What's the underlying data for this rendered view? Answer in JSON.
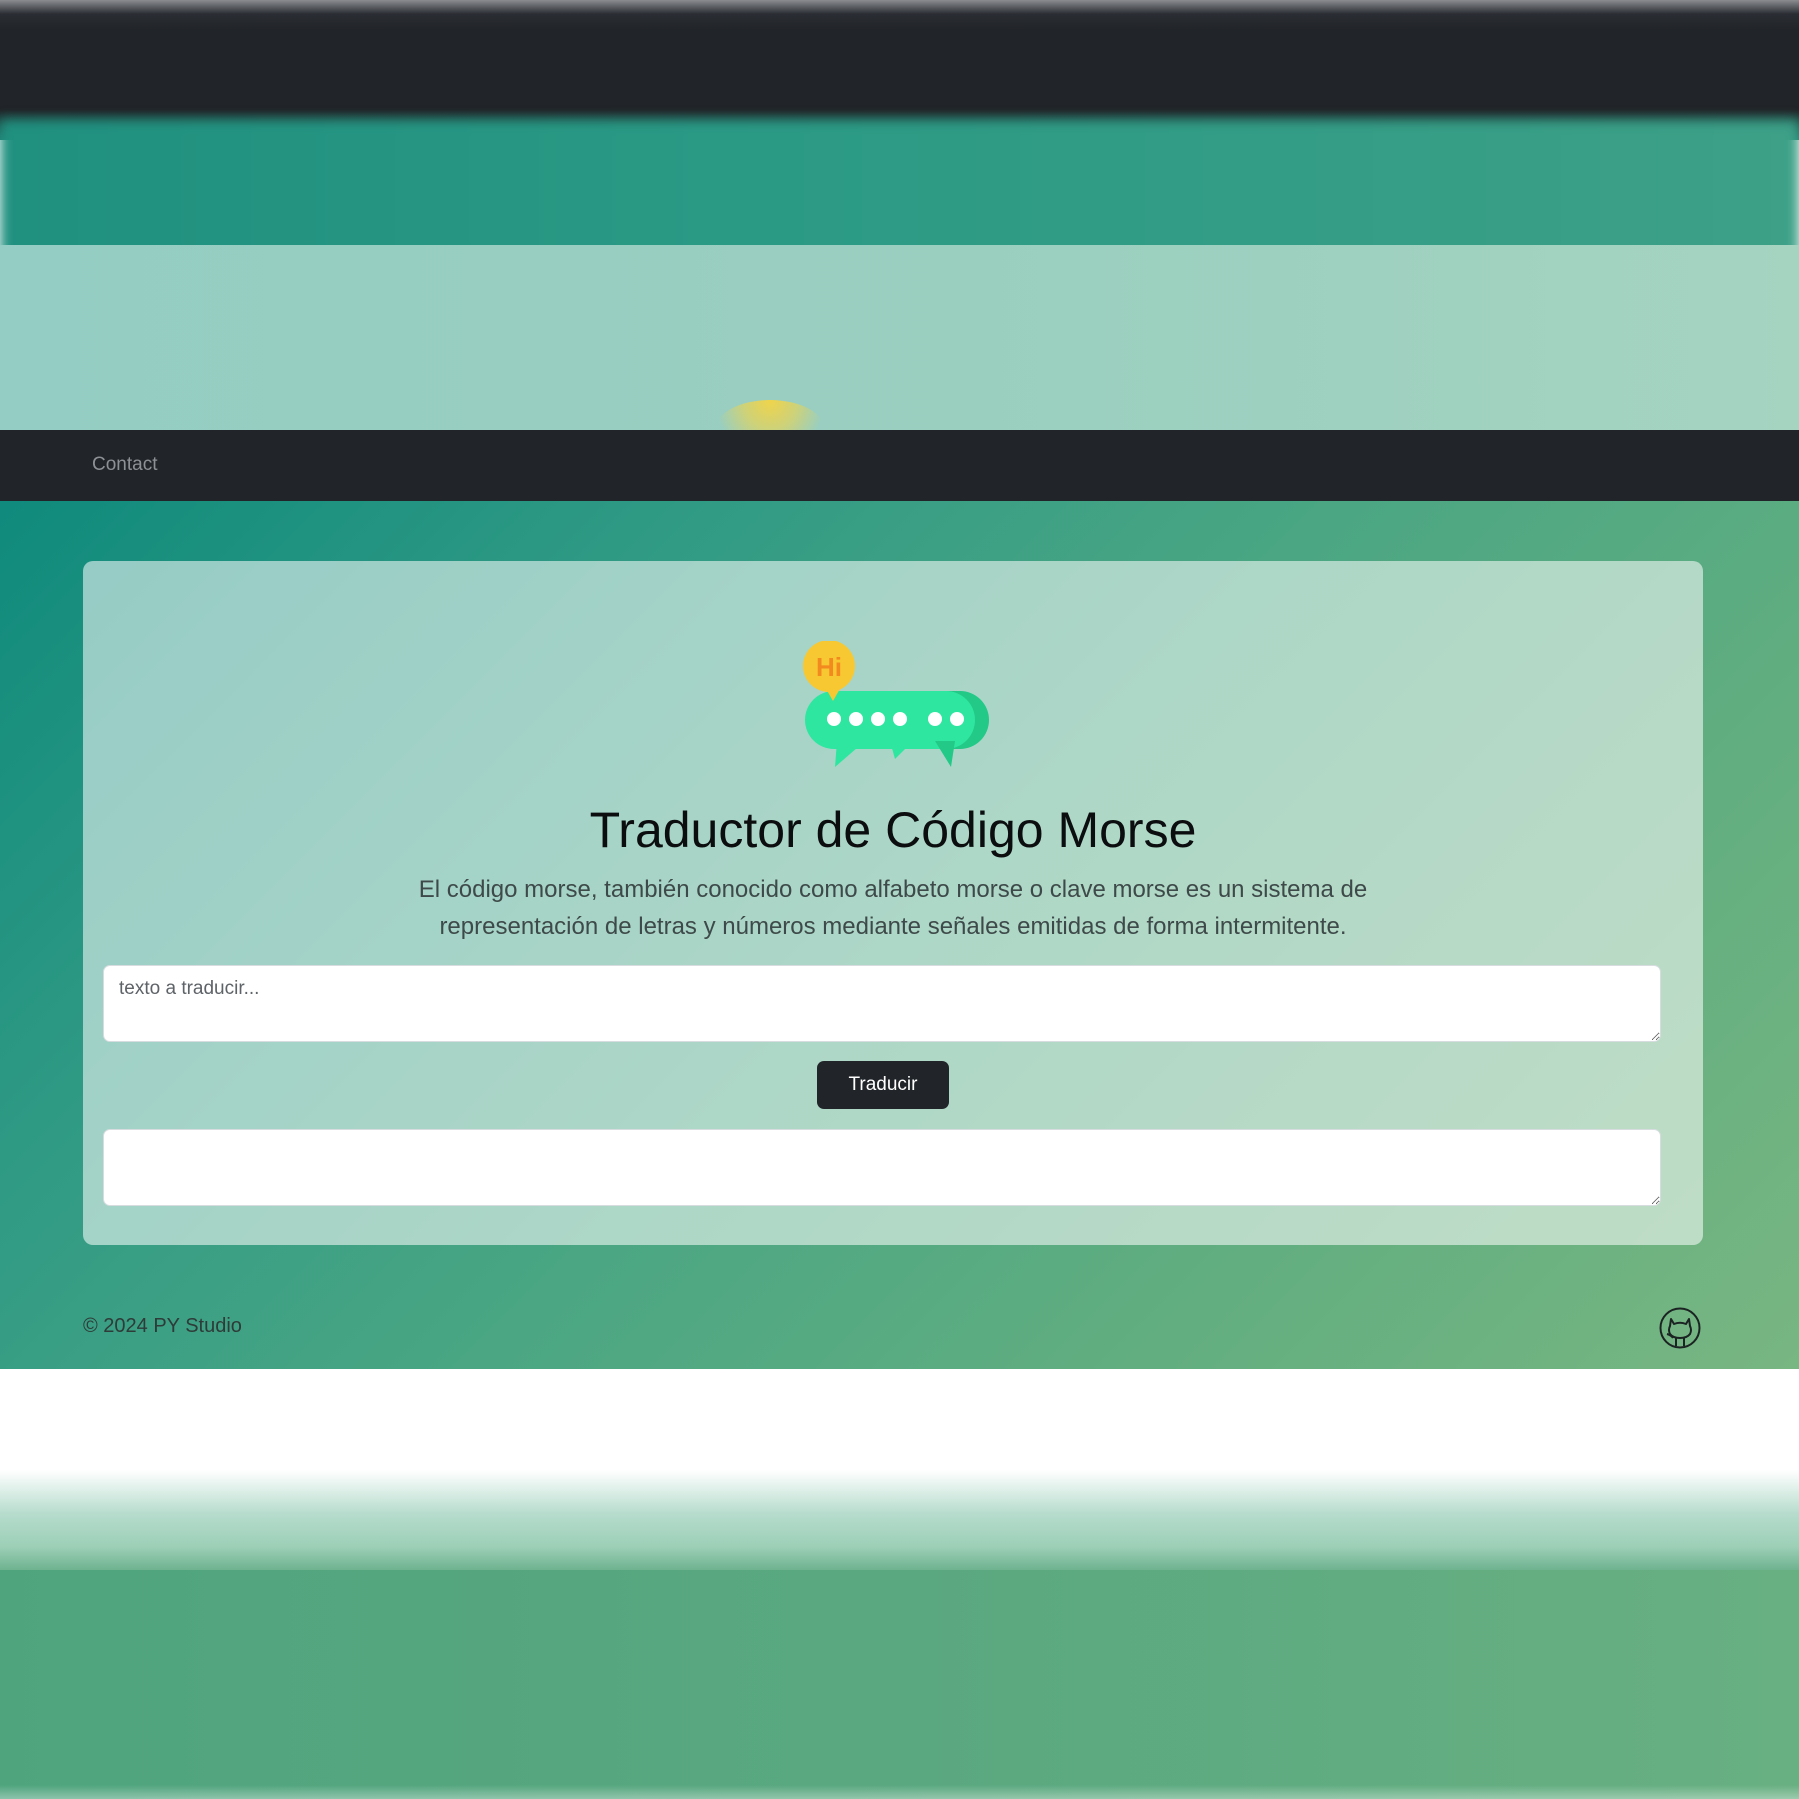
{
  "navbar": {
    "links": [
      {
        "label": "Contact"
      }
    ]
  },
  "hero": {
    "logo_badge_text": "Hi",
    "title": "Traductor de Código Morse",
    "description": "El código morse, también conocido como alfabeto morse o clave morse es un sistema de representación de letras y números mediante señales emitidas de forma intermitente."
  },
  "form": {
    "input": {
      "value": "",
      "placeholder": "texto a traducir..."
    },
    "button_label": "Traducir",
    "output": {
      "value": "",
      "placeholder": ""
    }
  },
  "footer": {
    "copyright": "© 2024 PY Studio",
    "icon": "github-icon"
  },
  "colors": {
    "navbar": "#212529",
    "button": "#212529",
    "gradient_start": "#0f8a7c",
    "gradient_end": "#78b682",
    "logo_bubble": "#2ee6a0",
    "logo_badge": "#f7c832"
  }
}
